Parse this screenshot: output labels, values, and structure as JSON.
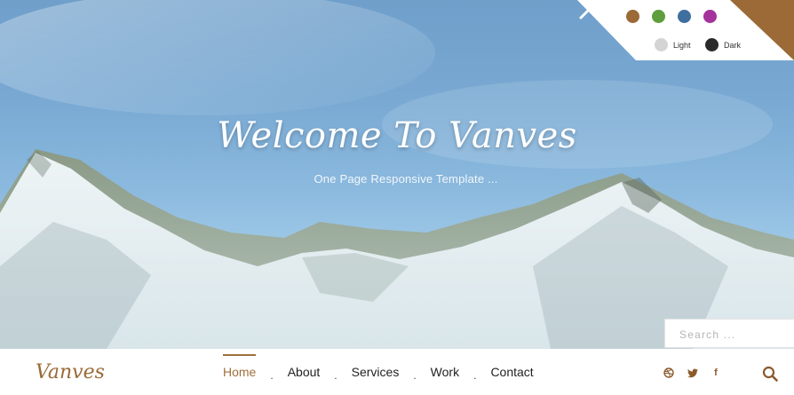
{
  "hero": {
    "title": "Welcome To Vanves",
    "subtitle": "One Page Responsive Template ..."
  },
  "switcher": {
    "colors": [
      {
        "name": "brown",
        "hex": "#9b6a36"
      },
      {
        "name": "green",
        "hex": "#5f9e3c"
      },
      {
        "name": "blue",
        "hex": "#3f6f9e"
      },
      {
        "name": "purple",
        "hex": "#a4339b"
      }
    ],
    "light_label": "Light",
    "dark_label": "Dark",
    "light_hex": "#d4d4d4",
    "dark_hex": "#2a2a2a",
    "accent_hex": "#9b6a36"
  },
  "search": {
    "placeholder": "Search ..."
  },
  "nav": {
    "logo": "Vanves",
    "items": [
      {
        "label": "Home",
        "active": true
      },
      {
        "label": "About"
      },
      {
        "label": "Services"
      },
      {
        "label": "Work"
      },
      {
        "label": "Contact"
      }
    ],
    "separator": ".",
    "social": [
      {
        "name": "dribbble-icon"
      },
      {
        "name": "twitter-icon"
      },
      {
        "name": "facebook-icon",
        "glyph": "f"
      }
    ]
  }
}
